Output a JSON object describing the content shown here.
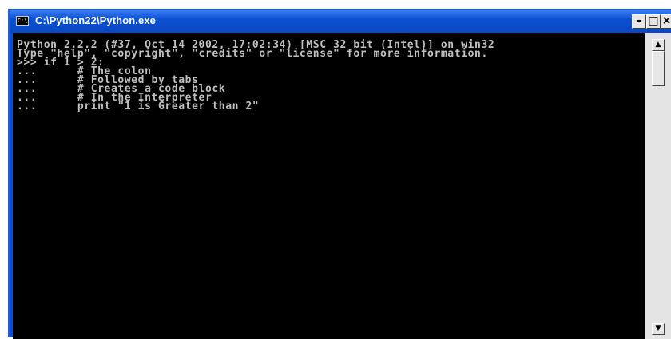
{
  "window": {
    "title": "C:\\Python22\\Python.exe",
    "icon": "console-icon",
    "icon_text": "C:\\",
    "buttons": {
      "minimize": "-",
      "maximize": "□",
      "close": "×"
    }
  },
  "console": {
    "lines": [
      "Python 2.2.2 (#37, Oct 14 2002, 17:02:34) [MSC 32 bit (Intel)] on win32",
      "Type \"help\", \"copyright\", \"credits\" or \"license\" for more information.",
      ">>> if 1 > 2:",
      "...      # The colon",
      "...      # Followed by tabs",
      "...      # Creates a code block",
      "...      # In the Interpreter",
      "...      print \"1 is Greater than 2\""
    ]
  },
  "scrollbar": {
    "up_arrow": "▲",
    "down_arrow": "▼"
  },
  "colors": {
    "titlebar": "#0b4fd0",
    "console_bg": "#000000",
    "console_text": "#c0c0c0"
  }
}
